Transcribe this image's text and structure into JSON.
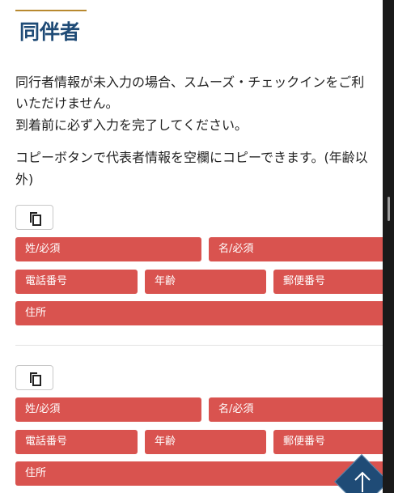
{
  "section": {
    "title": "同伴者",
    "desc_line1": "同行者情報が未入力の場合、スムーズ・チェックインをご利",
    "desc_line2": "いただけません。",
    "desc_line3": "到着前に必ず入力を完了してください。",
    "desc_line4": "コピーボタンで代表者情報を空欄にコピーできます。(年齢以",
    "desc_line5": "外)"
  },
  "companions": [
    {
      "copy_icon": "copy-icon",
      "last_name": "姓/必須",
      "first_name": "名/必須",
      "phone": "電話番号",
      "age": "年齢",
      "postal": "郵便番号",
      "address": "住所"
    },
    {
      "copy_icon": "copy-icon",
      "last_name": "姓/必須",
      "first_name": "名/必須",
      "phone": "電話番号",
      "age": "年齢",
      "postal": "郵便番号",
      "address": "住所"
    }
  ],
  "colors": {
    "field_bg": "#d9534f",
    "title": "#1f4b76",
    "title_rule": "#b8892f"
  },
  "scroll_top_icon": "arrow-up-icon"
}
